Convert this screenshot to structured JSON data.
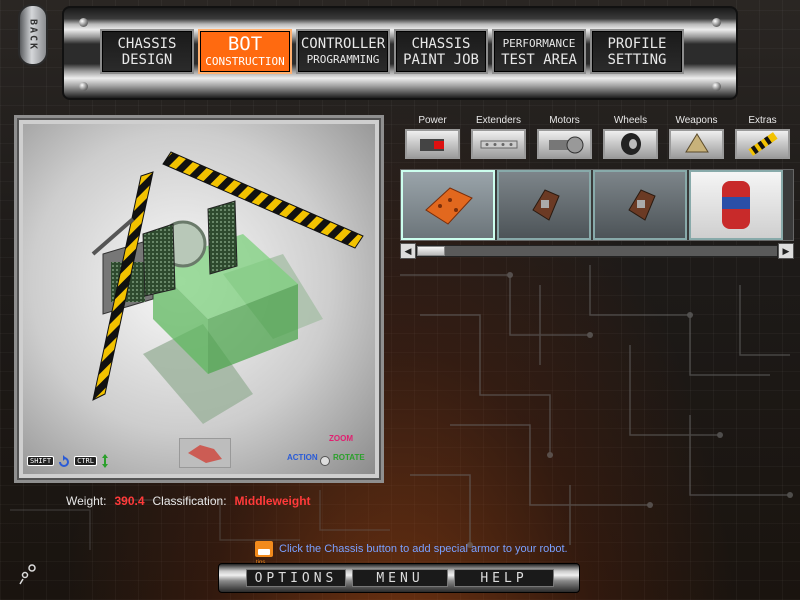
{
  "nav": {
    "back_label": "BACK",
    "tabs": [
      {
        "line1": "CHASSIS",
        "line2": "DESIGN",
        "active": false
      },
      {
        "line1": "BOT",
        "line2": "CONSTRUCTION",
        "active": true
      },
      {
        "line1": "CONTROLLER",
        "line2": "PROGRAMMING",
        "active": false
      },
      {
        "line1": "CHASSIS",
        "line2": "PAINT JOB",
        "active": false
      },
      {
        "line1": "PERFORMANCE",
        "line2": "TEST AREA",
        "active": false
      },
      {
        "line1": "PROFILE",
        "line2": "SETTING",
        "active": false
      }
    ]
  },
  "viewport": {
    "key_shift": "SHIFT",
    "key_ctrl": "CTRL",
    "action_label": "ACTION",
    "zoom_label": "ZOOM",
    "rotate_label": "ROTATE"
  },
  "stats": {
    "weight_label": "Weight:",
    "weight_value": "390.4",
    "class_label": "Classification:",
    "class_value": "Middleweight"
  },
  "parts": {
    "categories": [
      {
        "label": "Power",
        "icon": "battery-icon"
      },
      {
        "label": "Extenders",
        "icon": "extender-bar-icon"
      },
      {
        "label": "Motors",
        "icon": "motor-icon"
      },
      {
        "label": "Wheels",
        "icon": "wheel-icon"
      },
      {
        "label": "Weapons",
        "icon": "spike-icon"
      },
      {
        "label": "Extras",
        "icon": "hazard-stripe-icon"
      }
    ],
    "items": [
      {
        "icon": "armor-plate-orange-icon",
        "selected": true
      },
      {
        "icon": "armor-plate-dark-icon",
        "selected": false
      },
      {
        "icon": "armor-plate-dark-icon",
        "selected": false
      },
      {
        "icon": "canister-icon",
        "selected": false
      }
    ],
    "scroll_position": 0.0
  },
  "tip": {
    "text": "Click the Chassis button to add special armor to your robot."
  },
  "bottom": {
    "options_label": "OPTIONS",
    "menu_label": "MENU",
    "help_label": "HELP"
  },
  "colors": {
    "accent": "#ff6a10",
    "stat_value": "#ff3a3a",
    "tip_text": "#7aa0ff"
  }
}
